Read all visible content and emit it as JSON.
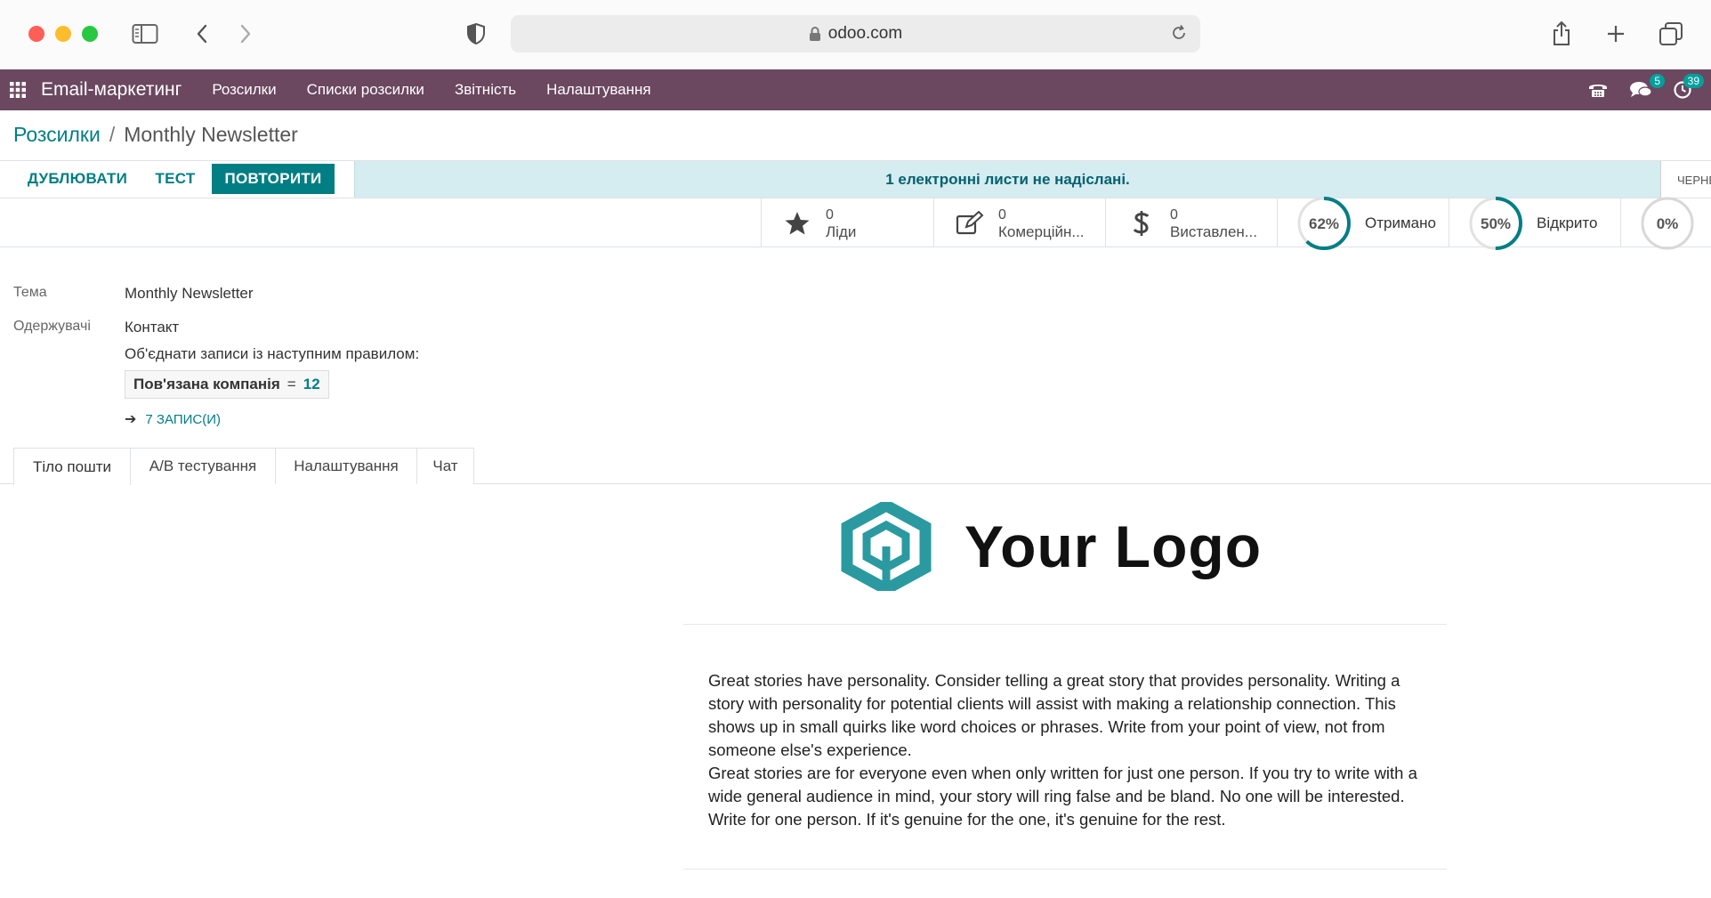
{
  "browser": {
    "url": "odoo.com"
  },
  "topnav": {
    "app_name": "Email-маркетинг",
    "menus": [
      "Розсилки",
      "Списки розсилки",
      "Звітність",
      "Налаштування"
    ],
    "messages_badge": "5",
    "activities_badge": "39",
    "accent_color": "#6b4760"
  },
  "breadcrumb": {
    "parent": "Розсилки",
    "separator": "/",
    "current": "Monthly Newsletter"
  },
  "actions": {
    "duplicate": "ДУБЛЮВАТИ",
    "test": "ТЕСТ",
    "retry": "ПОВТОРИТИ",
    "alert": "1 електронні листи не надіслані.",
    "status_cut": "ЧЕРНЕ"
  },
  "stats": {
    "leads": {
      "count": "0",
      "label": "Ліди",
      "icon": "star-icon"
    },
    "quotations": {
      "count": "0",
      "label": "Комерційн...",
      "icon": "edit-icon"
    },
    "invoiced": {
      "count": "0",
      "label": "Виставлен...",
      "icon": "dollar-icon"
    },
    "received": {
      "percent": "62%",
      "value": 0.62,
      "label": "Отримано"
    },
    "opened": {
      "percent": "50%",
      "value": 0.5,
      "label": "Відкрито"
    },
    "replied": {
      "percent": "0%",
      "value": 0.0
    }
  },
  "form": {
    "subject_label": "Тема",
    "subject_value": "Monthly Newsletter",
    "recipients_label": "Одержувачі",
    "recipients_value": "Контакт",
    "rule_text": "Об'єднати записи із наступним правилом:",
    "domain_field": "Пов'язана компанія",
    "domain_operator": "=",
    "domain_value": "12",
    "records_link": "7 ЗАПИС(И)"
  },
  "tabs": [
    "Тіло пошти",
    "A/B тестування",
    "Налаштування",
    "Чат"
  ],
  "email": {
    "logo_text": "Your Logo",
    "paragraph1": "Great stories have personality. Consider telling a great story that provides personality. Writing a story with personality for potential clients will assist with making a relationship connection. This shows up in small quirks like word choices or phrases. Write from your point of view, not from someone else's experience.",
    "paragraph2": "Great stories are for everyone even when only written for just one person. If you try to write with a wide general audience in mind, your story will ring false and be bland. No one will be interested. Write for one person. If it's genuine for the one, it's genuine for the rest."
  }
}
